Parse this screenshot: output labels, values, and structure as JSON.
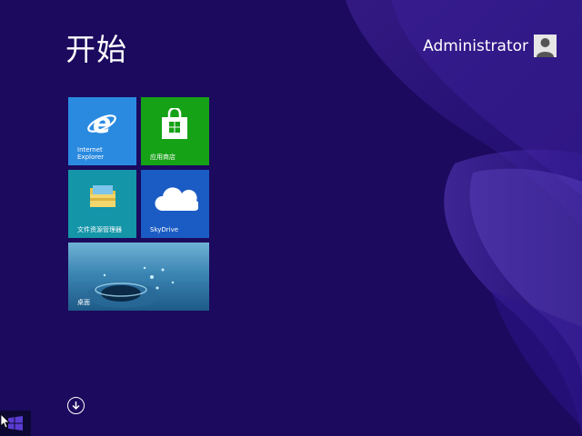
{
  "screen": {
    "title": "开始",
    "background_color": "#1b0a5e",
    "accent_color": "#3f2299"
  },
  "user": {
    "name": "Administrator",
    "avatar_icon": "user-silhouette-icon"
  },
  "tiles": [
    {
      "label": "Internet\nExplorer",
      "color": "#2a8ae0",
      "icon": "internet-explorer-icon"
    },
    {
      "label": "应用商店",
      "color": "#16a216",
      "icon": "store-bag-icon"
    },
    {
      "label": "文件资源管理器",
      "color": "#1495a8",
      "icon": "folder-icon"
    },
    {
      "label": "SkyDrive",
      "color": "#1b5cc4",
      "icon": "cloud-icon"
    },
    {
      "label": "桌面",
      "color": "#3c86b4",
      "icon": "water-drop-image"
    }
  ],
  "all_apps_button": {
    "icon": "down-arrow-circle-icon"
  },
  "taskbar": {
    "start_icon": "windows-logo-icon"
  }
}
